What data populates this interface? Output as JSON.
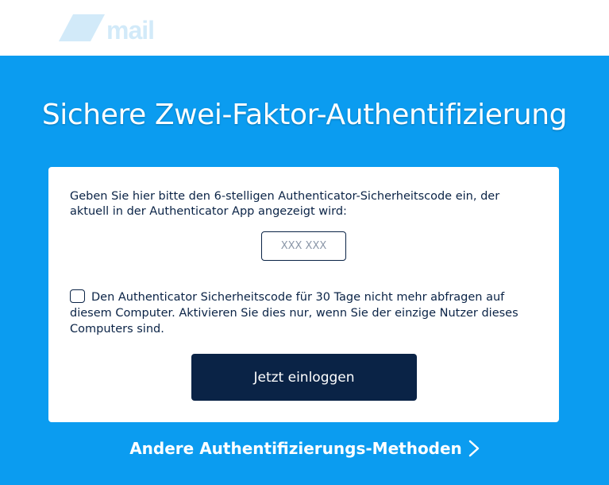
{
  "header": {
    "logo_text": "mail",
    "nav_items": [
      "",
      "",
      ""
    ]
  },
  "page": {
    "title": "Sichere Zwei-Faktor-Authentifizierung"
  },
  "card": {
    "instruction": "Geben Sie hier bitte den 6-stelligen Authenticator-Sicherheitscode ein, der aktuell in der Authenticator App angezeigt wird:",
    "code_placeholder": "XXX XXX",
    "code_value": "",
    "remember_label": "Den Authenticator Sicherheitscode für 30 Tage nicht mehr abfragen auf diesem Computer. Aktivieren Sie dies nur, wenn Sie der einzige Nutzer dieses Computers sind.",
    "remember_checked": false,
    "login_button": "Jetzt einloggen"
  },
  "footer": {
    "alt_methods_link": "Andere Authentifizierungs-Methoden",
    "chevron_icon": "chevron-right-icon"
  },
  "colors": {
    "background": "#0b9cf0",
    "navy": "#0a2346",
    "white": "#ffffff"
  }
}
